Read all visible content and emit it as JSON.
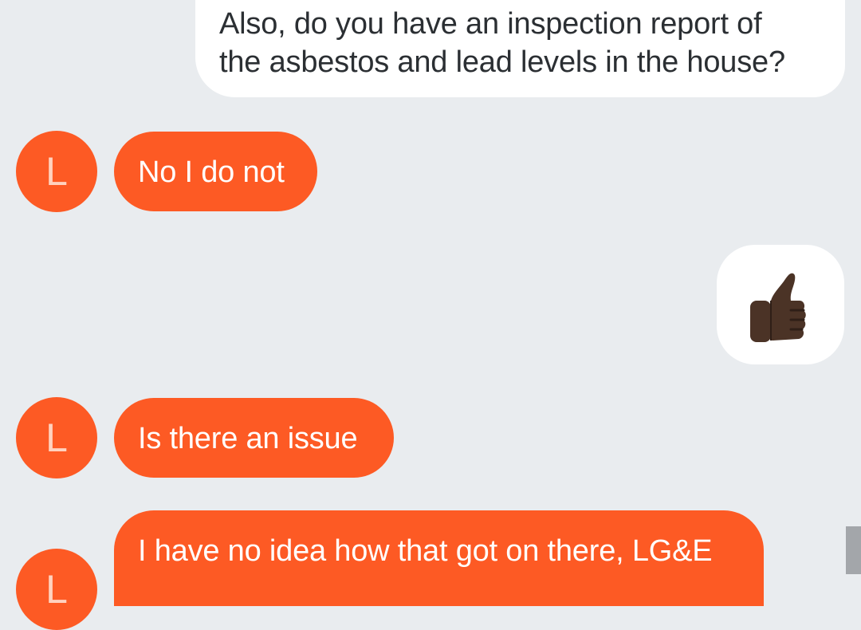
{
  "messages": [
    {
      "direction": "outgoing",
      "lines": [
        "Also, do you have an inspection report of",
        "the asbestos and lead levels in the house?"
      ]
    },
    {
      "direction": "incoming",
      "avatar_letter": "L",
      "text": "No I do not"
    },
    {
      "direction": "outgoing",
      "emoji": "thumbs-up-icon"
    },
    {
      "direction": "incoming",
      "avatar_letter": "L",
      "text": "Is there an issue"
    },
    {
      "direction": "incoming",
      "avatar_letter": "L",
      "text": "I have no idea how that got on there, LG&E"
    }
  ],
  "colors": {
    "background": "#e9ecef",
    "incoming_bubble": "#fd5a24",
    "outgoing_bubble": "#ffffff",
    "avatar_letter": "#ffd2bf"
  }
}
